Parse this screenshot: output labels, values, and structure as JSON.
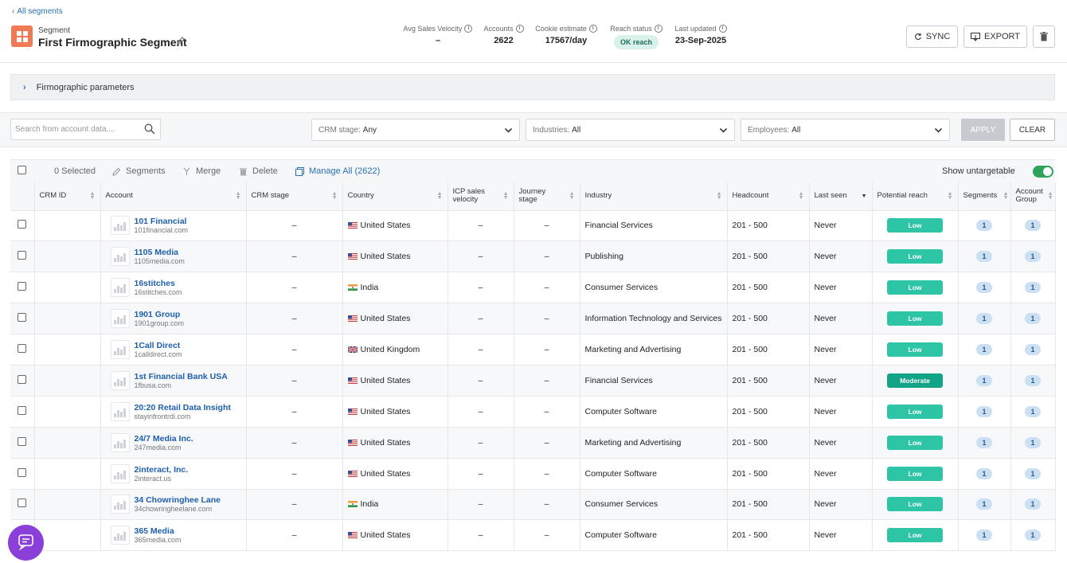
{
  "header": {
    "back_label": "All segments",
    "segment_small_label": "Segment",
    "segment_title": "First Firmographic Segment",
    "stats": {
      "velocity": {
        "label": "Avg Sales Velocity",
        "value": "–"
      },
      "accounts": {
        "label": "Accounts",
        "value": "2622"
      },
      "cookie": {
        "label": "Cookie estimate",
        "value": "17567/day"
      },
      "reach": {
        "label": "Reach status",
        "value": "OK reach"
      },
      "updated": {
        "label": "Last updated",
        "value": "23-Sep-2025"
      }
    },
    "sync_label": "SYNC",
    "export_label": "EXPORT"
  },
  "firmographic": {
    "label": "Firmographic parameters"
  },
  "filters": {
    "search_placeholder": "Search from account data....",
    "crm_key": "CRM stage:",
    "crm_val": "Any",
    "ind_key": "Industries:",
    "ind_val": "All",
    "emp_key": "Employees:",
    "emp_val": "All",
    "apply_label": "APPLY",
    "clear_label": "CLEAR"
  },
  "toolbar": {
    "selected": "0 Selected",
    "segments": "Segments",
    "merge": "Merge",
    "delete": "Delete",
    "manage_all": "Manage All (2622)",
    "show_untargetable": "Show untargetable",
    "show_untargetable_on": true
  },
  "columns": {
    "crm_id": "CRM ID",
    "account": "Account",
    "crm_stage": "CRM stage",
    "country": "Country",
    "icp": "ICP sales velocity",
    "journey": "Journey stage",
    "industry": "Industry",
    "headcount": "Headcount",
    "last_seen": "Last seen",
    "reach": "Potential reach",
    "segments": "Segments",
    "group": "Account Group"
  },
  "colors": {
    "low": "#2ec4a6",
    "moderate": "#13a386"
  },
  "rows": [
    {
      "name": "101 Financial",
      "domain": "101financial.com",
      "crm_id": "",
      "crm_stage": "–",
      "flag": "us",
      "country": "United States",
      "icp": "–",
      "journey": "–",
      "industry": "Financial Services",
      "headcount": "201 - 500",
      "last_seen": "Never",
      "reach": "Low",
      "segments": "1",
      "group": "1"
    },
    {
      "name": "1105 Media",
      "domain": "1105media.com",
      "crm_id": "",
      "crm_stage": "–",
      "flag": "us",
      "country": "United States",
      "icp": "–",
      "journey": "–",
      "industry": "Publishing",
      "headcount": "201 - 500",
      "last_seen": "Never",
      "reach": "Low",
      "segments": "1",
      "group": "1"
    },
    {
      "name": "16stitches",
      "domain": "16stitches.com",
      "crm_id": "",
      "crm_stage": "–",
      "flag": "in",
      "country": "India",
      "icp": "–",
      "journey": "–",
      "industry": "Consumer Services",
      "headcount": "201 - 500",
      "last_seen": "Never",
      "reach": "Low",
      "segments": "1",
      "group": "1"
    },
    {
      "name": "1901 Group",
      "domain": "1901group.com",
      "crm_id": "",
      "crm_stage": "–",
      "flag": "us",
      "country": "United States",
      "icp": "–",
      "journey": "–",
      "industry": "Information Technology and Services",
      "headcount": "201 - 500",
      "last_seen": "Never",
      "reach": "Low",
      "segments": "1",
      "group": "1"
    },
    {
      "name": "1Call Direct",
      "domain": "1calldirect.com",
      "crm_id": "",
      "crm_stage": "–",
      "flag": "uk",
      "country": "United Kingdom",
      "icp": "–",
      "journey": "–",
      "industry": "Marketing and Advertising",
      "headcount": "201 - 500",
      "last_seen": "Never",
      "reach": "Low",
      "segments": "1",
      "group": "1"
    },
    {
      "name": "1st Financial Bank USA",
      "domain": "1fbusa.com",
      "crm_id": "",
      "crm_stage": "–",
      "flag": "us",
      "country": "United States",
      "icp": "–",
      "journey": "–",
      "industry": "Financial Services",
      "headcount": "201 - 500",
      "last_seen": "Never",
      "reach": "Moderate",
      "segments": "1",
      "group": "1"
    },
    {
      "name": "20:20 Retail Data Insight",
      "domain": "stayinfrontrdi.com",
      "crm_id": "",
      "crm_stage": "–",
      "flag": "us",
      "country": "United States",
      "icp": "–",
      "journey": "–",
      "industry": "Computer Software",
      "headcount": "201 - 500",
      "last_seen": "Never",
      "reach": "Low",
      "segments": "1",
      "group": "1"
    },
    {
      "name": "24/7 Media Inc.",
      "domain": "247media.com",
      "crm_id": "",
      "crm_stage": "–",
      "flag": "us",
      "country": "United States",
      "icp": "–",
      "journey": "–",
      "industry": "Marketing and Advertising",
      "headcount": "201 - 500",
      "last_seen": "Never",
      "reach": "Low",
      "segments": "1",
      "group": "1"
    },
    {
      "name": "2interact, Inc.",
      "domain": "2interact.us",
      "crm_id": "",
      "crm_stage": "–",
      "flag": "us",
      "country": "United States",
      "icp": "–",
      "journey": "–",
      "industry": "Computer Software",
      "headcount": "201 - 500",
      "last_seen": "Never",
      "reach": "Low",
      "segments": "1",
      "group": "1"
    },
    {
      "name": "34 Chowringhee Lane",
      "domain": "34chowringheelane.com",
      "crm_id": "",
      "crm_stage": "–",
      "flag": "in",
      "country": "India",
      "icp": "–",
      "journey": "–",
      "industry": "Consumer Services",
      "headcount": "201 - 500",
      "last_seen": "Never",
      "reach": "Low",
      "segments": "1",
      "group": "1"
    },
    {
      "name": "365 Media",
      "domain": "365media.com",
      "crm_id": "",
      "crm_stage": "–",
      "flag": "us",
      "country": "United States",
      "icp": "–",
      "journey": "–",
      "industry": "Computer Software",
      "headcount": "201 - 500",
      "last_seen": "Never",
      "reach": "Low",
      "segments": "1",
      "group": "1"
    }
  ]
}
